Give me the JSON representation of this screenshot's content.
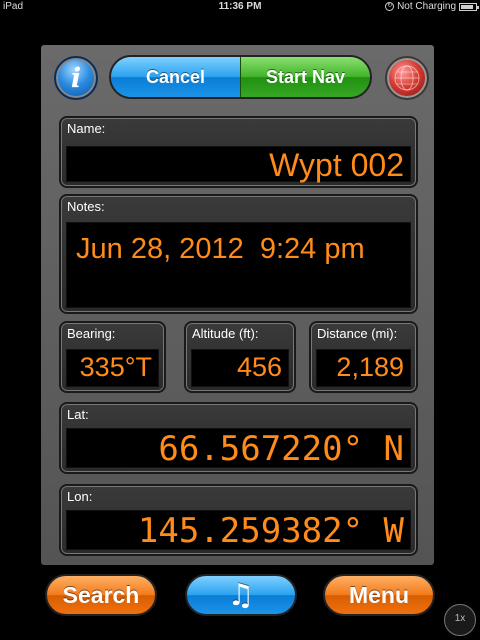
{
  "status_bar": {
    "device": "iPad",
    "time": "11:36 PM",
    "charging": "Not Charging"
  },
  "header": {
    "cancel_label": "Cancel",
    "start_nav_label": "Start Nav"
  },
  "fields": {
    "name": {
      "label": "Name:",
      "value": "Wypt 002"
    },
    "notes": {
      "label": "Notes:",
      "value": "Jun 28, 2012  9:24 pm"
    },
    "bearing": {
      "label": "Bearing:",
      "value": "335°T"
    },
    "altitude": {
      "label": "Altitude (ft):",
      "value": "456"
    },
    "distance": {
      "label": "Distance (mi):",
      "value": "2,189"
    },
    "lat": {
      "label": "Lat:",
      "value": "66.567220° N"
    },
    "lon": {
      "label": "Lon:",
      "value": "145.259382° W"
    }
  },
  "footer": {
    "search_label": "Search",
    "music_glyph": "♫",
    "menu_label": "Menu"
  },
  "zoom_label": "1x",
  "colors": {
    "value_text": "#ff8c1a",
    "accent_blue": "#2aa2ef",
    "accent_green": "#3fb32a",
    "accent_orange": "#f27a1a"
  },
  "icons": {
    "info": "info-icon",
    "globe": "globe-icon",
    "music": "music-note-icon",
    "battery": "battery-icon"
  }
}
